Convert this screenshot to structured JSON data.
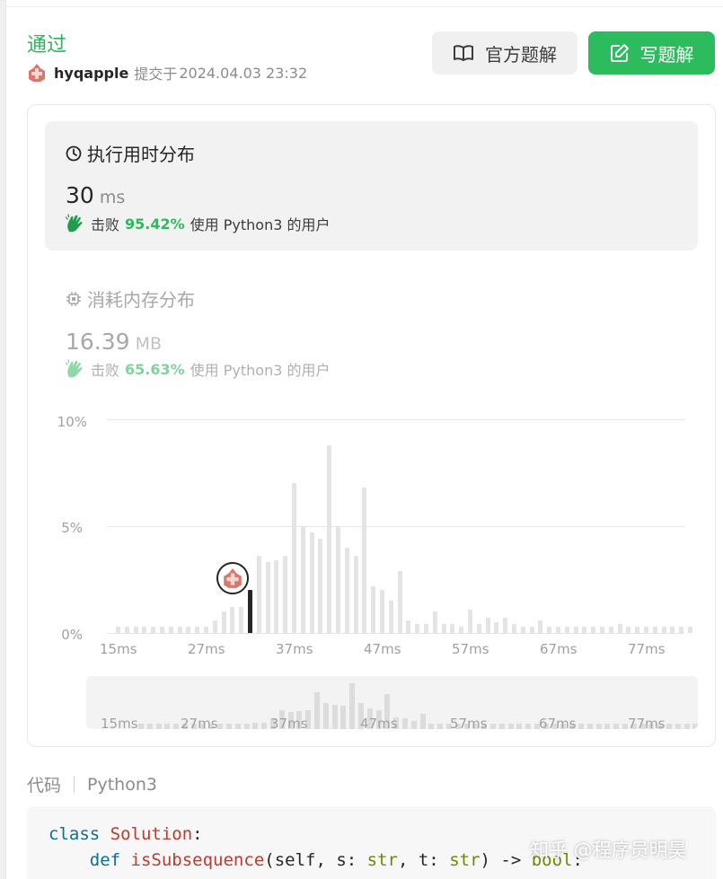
{
  "submission": {
    "status": "通过",
    "user": "hyqapple",
    "submitted_label": "提交于",
    "timestamp": "2024.04.03 23:32"
  },
  "buttons": {
    "official_solution": "官方题解",
    "write_solution": "写题解"
  },
  "runtime": {
    "title": "执行用时分布",
    "value": "30",
    "unit": "ms",
    "beat_prefix": "击败",
    "beat_percent": "95.42%",
    "beat_suffix": "使用 Python3 的用户"
  },
  "memory": {
    "title": "消耗内存分布",
    "value": "16.39",
    "unit": "MB",
    "beat_prefix": "击败",
    "beat_percent": "65.63%",
    "beat_suffix": "使用 Python3 的用户"
  },
  "chart_data": {
    "type": "bar",
    "y_ticks": [
      "10%",
      "5%",
      "0%"
    ],
    "ylim": [
      0,
      10
    ],
    "x_ticks": [
      "15ms",
      "27ms",
      "37ms",
      "47ms",
      "57ms",
      "67ms",
      "77ms"
    ],
    "highlight_ms": 30,
    "series": [
      {
        "values": [
          0.3,
          0.3,
          0.3,
          0.3,
          0.3,
          0.3,
          0.3,
          0.3,
          0.3,
          0.3,
          0.3,
          0.6,
          1.0,
          1.2,
          1.2,
          2.0,
          3.6,
          3.3,
          3.4,
          3.6,
          7.0,
          5.0,
          4.7,
          4.4,
          8.8,
          5.0,
          4.0,
          3.6,
          6.8,
          2.2,
          2.0,
          1.5,
          2.9,
          0.6,
          0.4,
          0.4,
          1.0,
          0.4,
          0.4,
          0.3,
          1.1,
          0.4,
          0.7,
          0.5,
          0.7,
          0.4,
          0.3,
          0.3,
          0.6,
          0.3,
          0.3,
          0.3,
          0.3,
          0.3,
          0.3,
          0.3,
          0.3,
          0.4,
          0.3,
          0.3,
          0.3,
          0.3,
          0.3,
          0.3,
          0.3,
          0.3
        ]
      }
    ]
  },
  "overview": {
    "x_ticks": [
      "15ms",
      "27ms",
      "37ms",
      "47ms",
      "57ms",
      "67ms",
      "77ms"
    ]
  },
  "code": {
    "label": "代码",
    "language": "Python3",
    "line1_kw": "class",
    "line1_name": "Solution",
    "line1_colon": ":",
    "line2_kw": "def",
    "line2_fn": "isSubsequence",
    "line2_a": "(self, s: ",
    "line2_t1": "str",
    "line2_b": ", t: ",
    "line2_t2": "str",
    "line2_c": ") -> ",
    "line2_t3": "bool",
    "line2_d": ":"
  },
  "watermark": "知乎 @程序员明昊",
  "colors": {
    "accent": "#2cbb5d",
    "bar": "#e4e4e4",
    "highlight_bar": "#262626"
  }
}
